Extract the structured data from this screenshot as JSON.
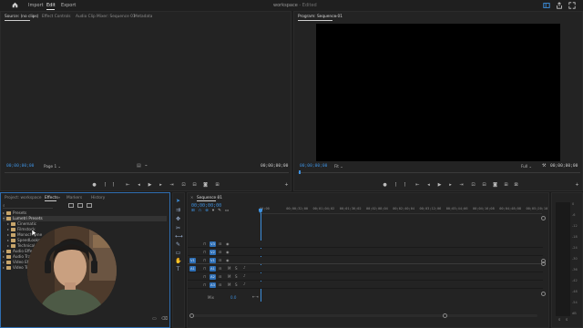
{
  "topbar": {
    "nav": [
      "Import",
      "Edit",
      "Export"
    ],
    "active": "Edit",
    "project": "workspace",
    "separator": "-",
    "status": "Edited"
  },
  "source": {
    "tabs": [
      "Source: (no clips)",
      "Effect Controls",
      "Audio Clip Mixer: Sequence 01",
      "Metadata"
    ],
    "timecode_left": "00;00;00;00",
    "page_label": "Page 1",
    "timecode_right": "00;00;00;00"
  },
  "program": {
    "tab": "Program: Sequence 01",
    "timecode_left": "00;00;00;00",
    "fit": "Fit",
    "full": "Full",
    "timecode_right": "00;00;00;00"
  },
  "project_panel": {
    "tabs": [
      "Project: workspace",
      "Effects",
      "Markers",
      "History"
    ],
    "active_tab": "Effects",
    "tree": [
      {
        "label": "Presets",
        "indent": 0,
        "expanded": false
      },
      {
        "label": "Lumetri Presets",
        "indent": 0,
        "expanded": true,
        "selected": true
      },
      {
        "label": "Cinematic",
        "indent": 1,
        "expanded": false
      },
      {
        "label": "Filmstock",
        "indent": 1,
        "expanded": false
      },
      {
        "label": "Monochrome",
        "indent": 1,
        "expanded": false
      },
      {
        "label": "SpeedLooks",
        "indent": 1,
        "expanded": false
      },
      {
        "label": "Technical",
        "indent": 1,
        "expanded": false
      },
      {
        "label": "Audio Effects",
        "indent": 0,
        "expanded": false
      },
      {
        "label": "Audio Transitions",
        "indent": 0,
        "expanded": false
      },
      {
        "label": "Video Effects",
        "indent": 0,
        "expanded": false
      },
      {
        "label": "Video Transitions",
        "indent": 0,
        "expanded": false
      }
    ]
  },
  "timeline": {
    "tab": "Sequence 01",
    "timecode": "00;00;00;00",
    "ruler": [
      "00;00",
      "00;00;32;00",
      "00;01;04;02",
      "00;01;36;02",
      "00;02;08;04",
      "00;02;40;04",
      "00;03;12;06",
      "00;03;44;06",
      "00;04;16;08",
      "00;04;48;08",
      "00;05;20;10"
    ],
    "video_tracks": [
      "V3",
      "V2",
      "V1"
    ],
    "audio_tracks": [
      "A1",
      "A2",
      "A3"
    ],
    "source_patch_video": "V1",
    "source_patch_audio": "A1",
    "mix_label": "Mix",
    "mix_value": "0.0",
    "track_button_m": "M",
    "track_button_s": "S"
  },
  "meter": {
    "ticks": [
      "0",
      "-6",
      "-12",
      "-18",
      "-24",
      "-30",
      "-36",
      "-42",
      "-48",
      "-54",
      "dB"
    ],
    "solo_labels": [
      "S",
      "S"
    ]
  },
  "colors": {
    "accent": "#3d8fdc",
    "panel": "#232323",
    "bg": "#1d1d1d",
    "folder": "#c7a56b",
    "track_target": "#2e6fb6"
  }
}
